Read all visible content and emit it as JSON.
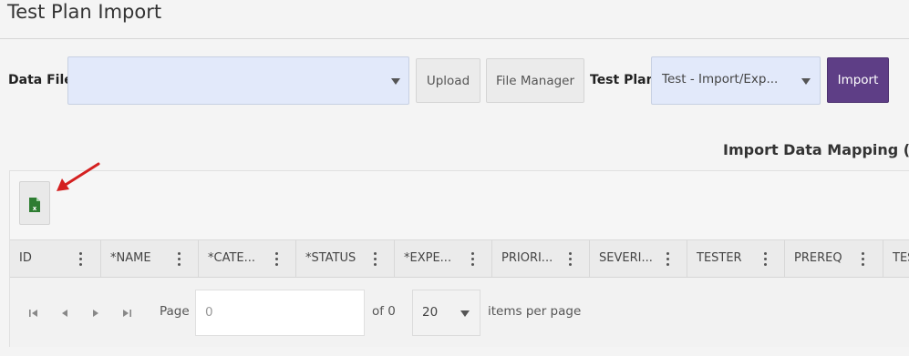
{
  "header": {
    "title": "Test Plan Import"
  },
  "form": {
    "data_file_label": "Data File",
    "data_file_value": "",
    "upload_label": "Upload",
    "file_manager_label": "File Manager",
    "test_plan_label": "Test Plan",
    "test_plan_value": "Test - Import/Exp...",
    "import_label": "Import"
  },
  "mapping": {
    "title": "Import Data Mapping (* Re"
  },
  "grid": {
    "columns": [
      {
        "label": "ID"
      },
      {
        "label": "*NAME"
      },
      {
        "label": "*CATE..."
      },
      {
        "label": "*STATUS"
      },
      {
        "label": "*EXPE..."
      },
      {
        "label": "PRIORI..."
      },
      {
        "label": "SEVERI..."
      },
      {
        "label": "TESTER"
      },
      {
        "label": "PREREQ"
      },
      {
        "label": "TES"
      }
    ],
    "excel_icon": "excel-export-icon"
  },
  "pager": {
    "page_label": "Page",
    "page_value": "0",
    "of_label": "of 0",
    "per_page_value": "20",
    "items_per_page_label": "items per page"
  },
  "colors": {
    "primary": "#5e3e86",
    "select_bg": "#e2e9fa",
    "annotation_arrow": "#d42020",
    "excel_green": "#2e7d32"
  }
}
